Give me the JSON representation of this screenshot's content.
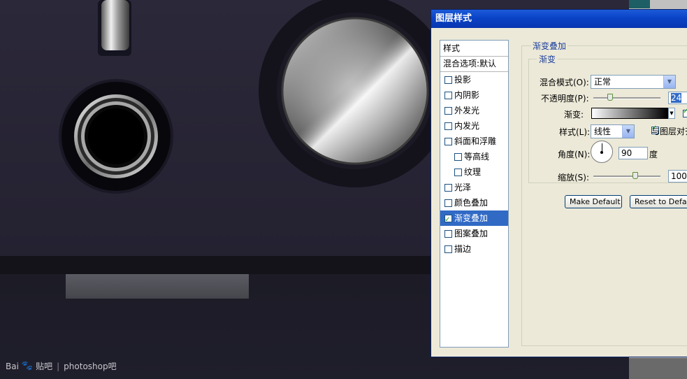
{
  "watermark": {
    "brand": "Bai",
    "brand_suffix": "贴吧",
    "separator": "|",
    "text": "photoshop吧"
  },
  "dialog": {
    "title": "图层样式",
    "styles_list": {
      "header": "样式",
      "blend_options": "混合选项:默认",
      "items": [
        {
          "label": "投影",
          "checked": false,
          "sub": false,
          "selected": false
        },
        {
          "label": "内阴影",
          "checked": false,
          "sub": false,
          "selected": false
        },
        {
          "label": "外发光",
          "checked": false,
          "sub": false,
          "selected": false
        },
        {
          "label": "内发光",
          "checked": false,
          "sub": false,
          "selected": false
        },
        {
          "label": "斜面和浮雕",
          "checked": false,
          "sub": false,
          "selected": false
        },
        {
          "label": "等高线",
          "checked": false,
          "sub": true,
          "selected": false
        },
        {
          "label": "纹理",
          "checked": false,
          "sub": true,
          "selected": false
        },
        {
          "label": "光泽",
          "checked": false,
          "sub": false,
          "selected": false
        },
        {
          "label": "颜色叠加",
          "checked": false,
          "sub": false,
          "selected": false
        },
        {
          "label": "渐变叠加",
          "checked": true,
          "sub": false,
          "selected": true
        },
        {
          "label": "图案叠加",
          "checked": false,
          "sub": false,
          "selected": false
        },
        {
          "label": "描边",
          "checked": false,
          "sub": false,
          "selected": false
        }
      ]
    },
    "panel": {
      "group_title": "渐变叠加",
      "sub_title": "渐变",
      "blend_mode_label": "混合模式(O):",
      "blend_mode_value": "正常",
      "opacity_label": "不透明度(P):",
      "opacity_value": "24",
      "gradient_label": "渐变:",
      "style_label": "样式(L):",
      "style_value": "线性",
      "align_label": "与图层对齐",
      "align_checked": true,
      "angle_label": "角度(N):",
      "angle_value": "90",
      "angle_unit": "度",
      "scale_label": "缩放(S):",
      "scale_value": "100",
      "make_default": "Make Default",
      "reset_default": "Reset to Default"
    }
  },
  "colors": {
    "titlebar": "#0a43c6",
    "dialog_bg": "#ece9d8",
    "selection": "#316ac5",
    "canvas_bg": "#23212f"
  }
}
